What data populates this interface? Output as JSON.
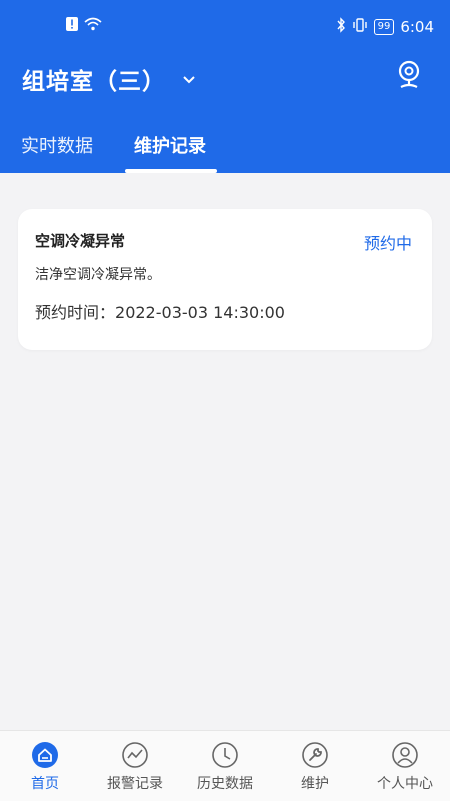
{
  "status_bar": {
    "time": "6:04",
    "battery": "99"
  },
  "header": {
    "title": "组培室（三）"
  },
  "tabs": [
    {
      "label": "实时数据"
    },
    {
      "label": "维护记录"
    }
  ],
  "record": {
    "title": "空调冷凝异常",
    "status": "预约中",
    "description": "洁净空调冷凝异常。",
    "time_label": "预约时间：",
    "time_value": "2022-03-03 14:30:00"
  },
  "bottom_nav": [
    {
      "label": "首页"
    },
    {
      "label": "报警记录"
    },
    {
      "label": "历史数据"
    },
    {
      "label": "维护"
    },
    {
      "label": "个人中心"
    }
  ],
  "colors": {
    "primary": "#1f6ae8",
    "background": "#f3f3f5"
  }
}
